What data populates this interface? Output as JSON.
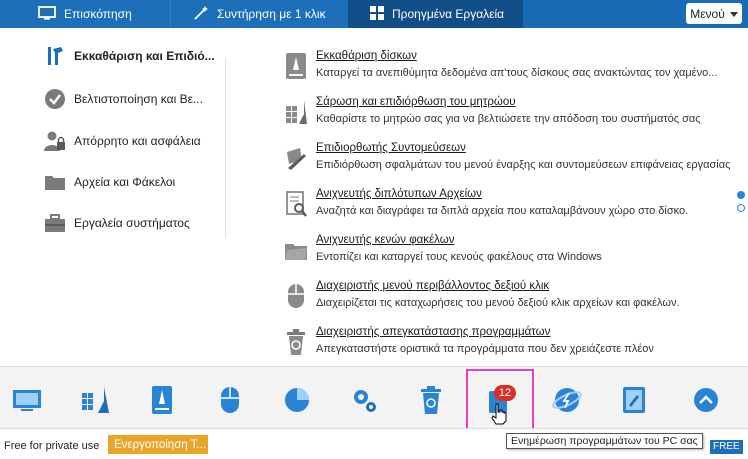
{
  "topbar": {
    "tabs": [
      {
        "label": "Επισκόπηση"
      },
      {
        "label": "Συντήρηση με 1 κλικ"
      },
      {
        "label": "Προηγμένα Εργαλεία"
      }
    ],
    "menu_label": "Μενού"
  },
  "categories": [
    {
      "label": "Εκκαθάριση και Επιδιό...",
      "icon": "cleanup-icon"
    },
    {
      "label": "Βελτιστοποίηση και Βε...",
      "icon": "checkmark-icon"
    },
    {
      "label": "Απόρρητο και ασφάλεια",
      "icon": "privacy-icon"
    },
    {
      "label": "Αρχεία και Φάκελοι",
      "icon": "folder-icon"
    },
    {
      "label": "Εργαλεία συστήματος",
      "icon": "toolbox-icon"
    }
  ],
  "tools": [
    {
      "title": "Εκκαθάριση δίσκων",
      "desc": "Καταργεί τα ανεπιθύμητα δεδομένα απ'τους δίσκους σας ανακτώντας τον χαμένο..."
    },
    {
      "title": "Σάρωση και επιδιόρθωση του μητρώου",
      "desc": "Καθαρίστε το μητρώο σας για να βελτιώσετε την απόδοση του συστήματός σας"
    },
    {
      "title": "Επιδιορθωτής Συντομεύσεων",
      "desc": "Επιδιόρθωση σφαλμάτων του μενού έναρξης και συντομεύσεων επιφάνειας εργασίας"
    },
    {
      "title": "Ανιχνευτής διπλότυπων Αρχείων",
      "desc": "Αναζητά και διαγράφει τα διπλά αρχεία που καταλαμβάνουν χώρο στο δίσκο."
    },
    {
      "title": "Ανιχνευτής κενών φακέλων",
      "desc": "Εντοπίζει και καταργεί τους κενούς φακέλους στα Windows"
    },
    {
      "title": "Διαχειριστής μενού περιβάλλοντος δεξιού κλικ",
      "desc": "Διαχειρίζεται τις καταχωρήσεις του μενού δεξιού κλικ αρχείων και φακέλων."
    },
    {
      "title": "Διαχειριστής απεγκατάστασης προγραμμάτων",
      "desc": "Απεγκαταστήστε οριστικά τα προγράμματα που δεν χρειάζεστε πλέον"
    }
  ],
  "dock": {
    "badge": "12",
    "icons": [
      "monitor-icon",
      "registry-broom-icon",
      "disk-icon",
      "mouse-icon",
      "pie-chart-icon",
      "gears-icon",
      "recycle-bin-icon",
      "update-icon",
      "globe-icon",
      "book-icon",
      "chevron-up-icon"
    ]
  },
  "status": {
    "text": "Free for private use",
    "activate": "Ενεργοποίηση Τ...",
    "tooltip": "Ενημέρωση προγραμμάτων του PC σας",
    "free": "FREE"
  },
  "colors": {
    "topbar": "#1d6fb9",
    "active_tab": "#114e88",
    "highlight": "#e040c8",
    "badge": "#d93025",
    "activate": "#e8a52a"
  }
}
